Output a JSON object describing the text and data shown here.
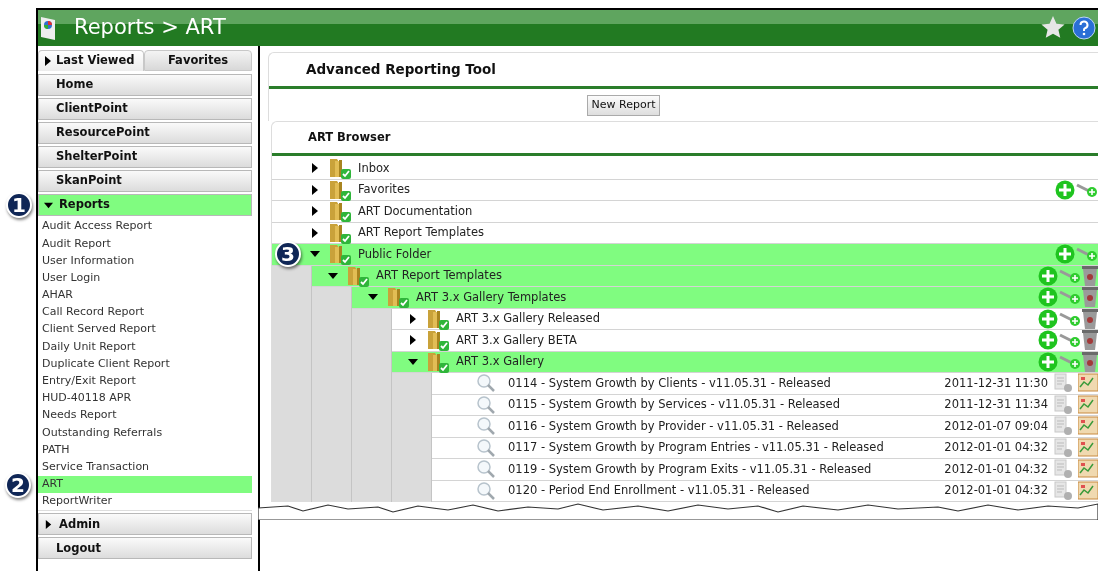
{
  "title": "Reports > ART",
  "sidebar": {
    "tabs": [
      {
        "label": "Last Viewed",
        "selected": true
      },
      {
        "label": "Favorites",
        "selected": false
      }
    ],
    "nav": [
      {
        "kind": "button",
        "label": "Home"
      },
      {
        "kind": "button",
        "label": "ClientPoint"
      },
      {
        "kind": "button",
        "label": "ResourcePoint"
      },
      {
        "kind": "button",
        "label": "ShelterPoint"
      },
      {
        "kind": "button",
        "label": "SkanPoint"
      },
      {
        "kind": "section",
        "label": "Reports",
        "expanded": true,
        "callout": "1",
        "children": [
          {
            "label": "Audit Access Report",
            "selected": false
          },
          {
            "label": "Audit Report",
            "selected": false
          },
          {
            "label": "User Information",
            "selected": false
          },
          {
            "label": "User Login",
            "selected": false
          },
          {
            "label": "AHAR",
            "selected": false
          },
          {
            "label": "Call Record Report",
            "selected": false
          },
          {
            "label": "Client Served Report",
            "selected": false
          },
          {
            "label": "Daily Unit Report",
            "selected": false
          },
          {
            "label": "Duplicate Client Report",
            "selected": false
          },
          {
            "label": "Entry/Exit Report",
            "selected": false
          },
          {
            "label": "HUD-40118 APR",
            "selected": false
          },
          {
            "label": "Needs Report",
            "selected": false
          },
          {
            "label": "Outstanding Referrals",
            "selected": false
          },
          {
            "label": "PATH",
            "selected": false
          },
          {
            "label": "Service Transaction",
            "selected": false
          },
          {
            "label": "ART",
            "selected": true,
            "callout": "2"
          },
          {
            "label": "ReportWriter",
            "selected": false
          }
        ]
      },
      {
        "kind": "section",
        "label": "Admin",
        "expanded": false
      },
      {
        "kind": "button",
        "label": "Logout"
      }
    ]
  },
  "main": {
    "heading": "Advanced Reporting Tool",
    "new_report_button": "New Report",
    "browser": {
      "title": "ART Browser",
      "tree": [
        {
          "kind": "folder",
          "label": "Inbox",
          "expanded": false,
          "selected": false,
          "can_add": false,
          "can_share": false,
          "can_delete": false
        },
        {
          "kind": "folder",
          "label": "Favorites",
          "expanded": false,
          "selected": false,
          "can_add": true,
          "can_share": true,
          "can_delete": false
        },
        {
          "kind": "folder",
          "label": "ART Documentation",
          "expanded": false,
          "selected": false,
          "can_add": false,
          "can_share": false,
          "can_delete": false
        },
        {
          "kind": "folder",
          "label": "ART Report Templates",
          "expanded": false,
          "selected": false,
          "can_add": false,
          "can_share": false,
          "can_delete": false
        },
        {
          "kind": "folder",
          "label": "Public Folder",
          "expanded": true,
          "selected": true,
          "callout": "3",
          "can_add": true,
          "can_share": true,
          "can_delete": false,
          "children": [
            {
              "kind": "folder",
              "label": "ART Report Templates",
              "expanded": true,
              "selected": true,
              "can_add": true,
              "can_share": true,
              "can_delete": true,
              "children": [
                {
                  "kind": "folder",
                  "label": "ART 3.x Gallery Templates",
                  "expanded": true,
                  "selected": true,
                  "can_add": true,
                  "can_share": true,
                  "can_delete": true,
                  "children": [
                    {
                      "kind": "folder",
                      "label": "ART 3.x Gallery Released",
                      "expanded": false,
                      "selected": false,
                      "can_add": true,
                      "can_share": true,
                      "can_delete": true
                    },
                    {
                      "kind": "folder",
                      "label": "ART 3.x Gallery BETA",
                      "expanded": false,
                      "selected": false,
                      "can_add": true,
                      "can_share": true,
                      "can_delete": true
                    },
                    {
                      "kind": "folder",
                      "label": "ART 3.x Gallery",
                      "expanded": true,
                      "selected": true,
                      "can_add": true,
                      "can_share": true,
                      "can_delete": true,
                      "children": [
                        {
                          "kind": "report",
                          "label": "0114 - System Growth by Clients - v11.05.31 - Released",
                          "date": "2011-12-31 11:30"
                        },
                        {
                          "kind": "report",
                          "label": "0115 - System Growth by Services - v11.05.31 - Released",
                          "date": "2011-12-31 11:34"
                        },
                        {
                          "kind": "report",
                          "label": "0116 - System Growth by Provider - v11.05.31 - Released",
                          "date": "2012-01-07 09:04"
                        },
                        {
                          "kind": "report",
                          "label": "0117 - System Growth by Program Entries - v11.05.31 - Released",
                          "date": "2012-01-01 04:32"
                        },
                        {
                          "kind": "report",
                          "label": "0119 - System Growth by Program Exits - v11.05.31 - Released",
                          "date": "2012-01-01 04:32"
                        },
                        {
                          "kind": "report",
                          "label": "0120 - Period End Enrollment - v11.05.31 - Released",
                          "date": "2012-01-01 04:32"
                        }
                      ]
                    }
                  ]
                }
              ]
            }
          ]
        }
      ]
    }
  }
}
